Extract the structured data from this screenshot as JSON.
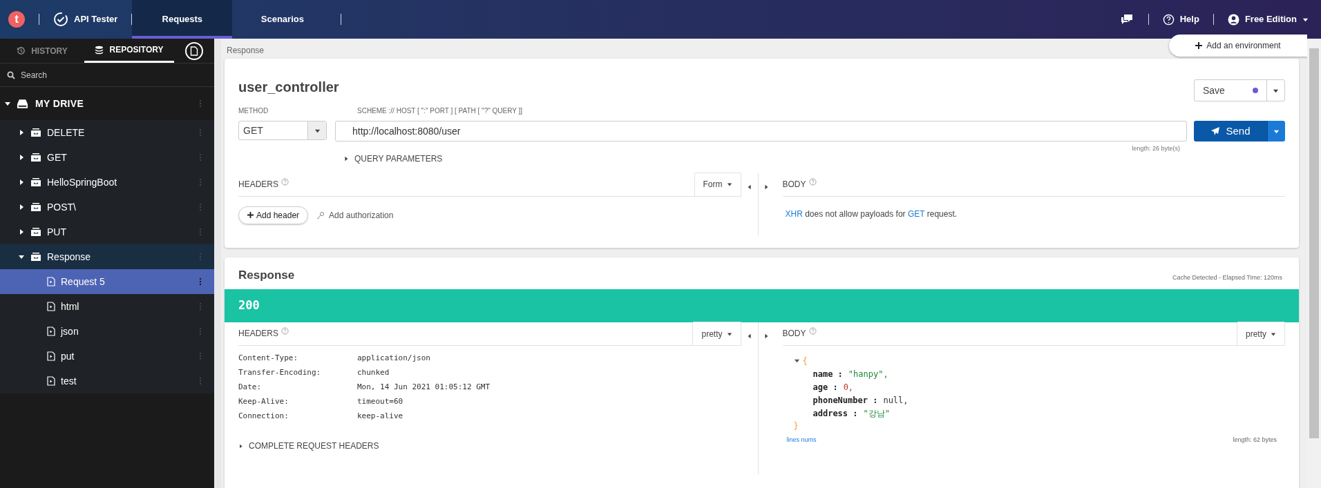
{
  "topbar": {
    "logo": "t",
    "app": "API Tester",
    "tabs": [
      {
        "label": "Requests",
        "selected": true
      },
      {
        "label": "Scenarios",
        "selected": false
      }
    ],
    "help": "Help",
    "account": "Free Edition"
  },
  "sidebar": {
    "tabs": [
      {
        "label": "HISTORY",
        "selected": false
      },
      {
        "label": "REPOSITORY",
        "selected": true
      }
    ],
    "search": {
      "placeholder": "Search"
    },
    "tree": [
      {
        "label": "MY DRIVE",
        "kind": "drive",
        "expanded": true,
        "selected": false,
        "children": [
          {
            "label": "DELETE",
            "kind": "folder",
            "expanded": false,
            "selected": false
          },
          {
            "label": "GET",
            "kind": "folder",
            "expanded": false,
            "selected": false
          },
          {
            "label": "HelloSpringBoot",
            "kind": "folder",
            "expanded": false,
            "selected": false
          },
          {
            "label": "POST\\",
            "kind": "folder",
            "expanded": false,
            "selected": false
          },
          {
            "label": "PUT",
            "kind": "folder",
            "expanded": false,
            "selected": false
          },
          {
            "label": "Response",
            "kind": "folder",
            "expanded": true,
            "selected": false,
            "children": [
              {
                "label": "Request 5",
                "kind": "request",
                "selected": true
              },
              {
                "label": "html",
                "kind": "request",
                "selected": false
              },
              {
                "label": "json",
                "kind": "request",
                "selected": false
              },
              {
                "label": "put",
                "kind": "request",
                "selected": false
              },
              {
                "label": "test",
                "kind": "request",
                "selected": false
              }
            ]
          }
        ]
      }
    ]
  },
  "breadcrumb": "Response",
  "add_environment": "Add an environment",
  "request": {
    "name": "user_controller",
    "save": {
      "label": "Save",
      "unsaved": true
    },
    "method_label": "METHOD",
    "method": "GET",
    "url_label": "SCHEME :// HOST [ \":\" PORT ] [ PATH [ \"?\" QUERY ]]",
    "url": "http://localhost:8080/user",
    "send": "Send",
    "length": "length: 26 byte(s)",
    "query_parameters": "QUERY PARAMETERS",
    "headers": {
      "title": "HEADERS",
      "mode": "Form",
      "add_header": "Add header",
      "add_authorization": "Add authorization"
    },
    "body": {
      "title": "BODY",
      "message": "**XHR** does not allow payloads for **GET** request."
    }
  },
  "response": {
    "title": "Response",
    "timing": "Cache Detected - Elapsed Time: 120ms",
    "status": "200",
    "headers": {
      "title": "HEADERS",
      "mode": "pretty",
      "rows": [
        {
          "name": "Content-Type:",
          "value": "application/json"
        },
        {
          "name": "Transfer-Encoding:",
          "value": "chunked"
        },
        {
          "name": "Date:",
          "value": "Mon, 14 Jun 2021 01:05:12 GMT"
        },
        {
          "name": "Keep-Alive:",
          "value": "timeout=60"
        },
        {
          "name": "Connection:",
          "value": "keep-alive"
        }
      ],
      "complete": "COMPLETE REQUEST HEADERS"
    },
    "body": {
      "title": "BODY",
      "mode": "pretty",
      "open": "{",
      "close": "}",
      "fields": [
        {
          "key": "name :",
          "value": "\"hanpy\",",
          "kind": "string"
        },
        {
          "key": "age :",
          "value": "0,",
          "kind": "number"
        },
        {
          "key": "phoneNumber :",
          "value": "null,",
          "kind": "null"
        },
        {
          "key": "address :",
          "value": "\"강남\"",
          "kind": "string"
        }
      ],
      "lines_nums": "lines nums",
      "length": "length: 62 bytes"
    }
  }
}
